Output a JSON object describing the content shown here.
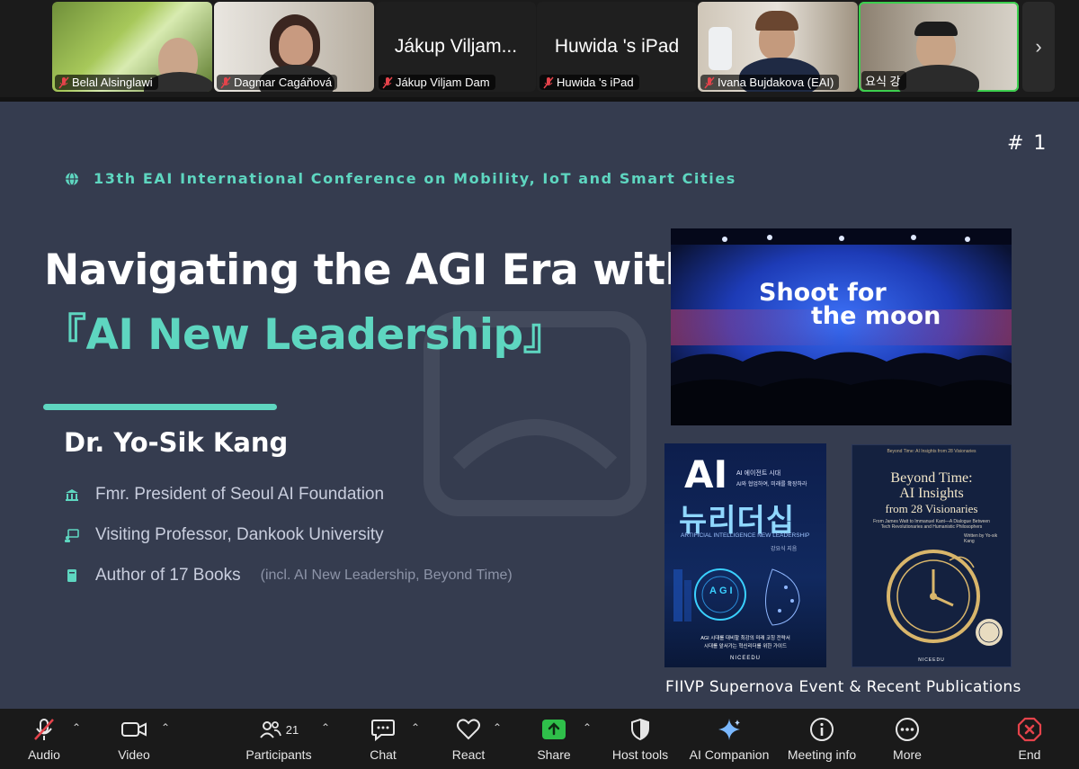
{
  "participants": [
    {
      "name": "Belal Alsinglawi",
      "big_label": "",
      "muted": true,
      "active": false
    },
    {
      "name": "Dagmar Cagáňová",
      "big_label": "",
      "muted": true,
      "active": false
    },
    {
      "name": "Jákup Viljam Dam",
      "big_label": "Jákup Viljam...",
      "muted": true,
      "active": false
    },
    {
      "name": "Huwida 's iPad",
      "big_label": "Huwida 's iPad",
      "muted": true,
      "active": false
    },
    {
      "name": "Ivana Bujdakova (EAI)",
      "big_label": "",
      "muted": true,
      "active": false
    },
    {
      "name": "요식 강",
      "big_label": "",
      "muted": false,
      "active": true
    }
  ],
  "slide": {
    "number": "# 1",
    "conference": "13th EAI International Conference on Mobility, IoT and Smart Cities",
    "title_line1": "Navigating the AGI Era with",
    "title_line2": "『AI New Leadership』",
    "speaker": "Dr. Yo-Sik Kang",
    "bullets": [
      {
        "icon": "building-icon",
        "text": "Fmr. President of Seoul AI Foundation",
        "sub": ""
      },
      {
        "icon": "presentation-icon",
        "text": "Visiting Professor, Dankook University",
        "sub": ""
      },
      {
        "icon": "book-icon",
        "text": "Author of 17 Books",
        "sub": "(incl. AI New Leadership, Beyond Time)"
      }
    ],
    "event_photo_text_1": "Shoot for",
    "event_photo_text_2": "the moon",
    "book1": {
      "big": "AI",
      "korean_title": "뉴리더십",
      "tag1": "AI 에이전트 시대",
      "tag2": "AI와 협업하여, 미래를 확장하라",
      "english": "ARTIFICIAL INTELLIGENCE NEW LEADERSHIP",
      "author": "강요식 지음",
      "agi": "AGI",
      "bottom1": "AGI 시대를 대비할 최강의 미래 코칭 전략서",
      "bottom2": "시대를 앞서가는 혁신리더를 위한 가이드",
      "publisher": "NICEEDU"
    },
    "book2": {
      "top": "Beyond Time: AI Insights from 28 Visionaries",
      "title1": "Beyond Time:",
      "title2": "AI Insights",
      "title3": "from 28 Visionaries",
      "sub": "From James Watt to Immanuel Kant—A Dialogue Between Tech Revolutionaries and Humanistic Philosophers",
      "author": "Written by Yo-sik Kang",
      "publisher": "NICEEDU"
    },
    "caption": "FIIVP Supernova Event & Recent Publications"
  },
  "toolbar": {
    "audio": "Audio",
    "video": "Video",
    "participants": "Participants",
    "participants_count": "21",
    "chat": "Chat",
    "react": "React",
    "share": "Share",
    "host_tools": "Host tools",
    "ai_companion": "AI Companion",
    "meeting_info": "Meeting info",
    "more": "More",
    "end": "End"
  },
  "colors": {
    "slide_bg": "#353c4f",
    "accent_teal": "#5ed6c0",
    "share_green": "#2fbf4a",
    "end_red": "#e5434b",
    "active_speaker": "#3ccf4e"
  }
}
